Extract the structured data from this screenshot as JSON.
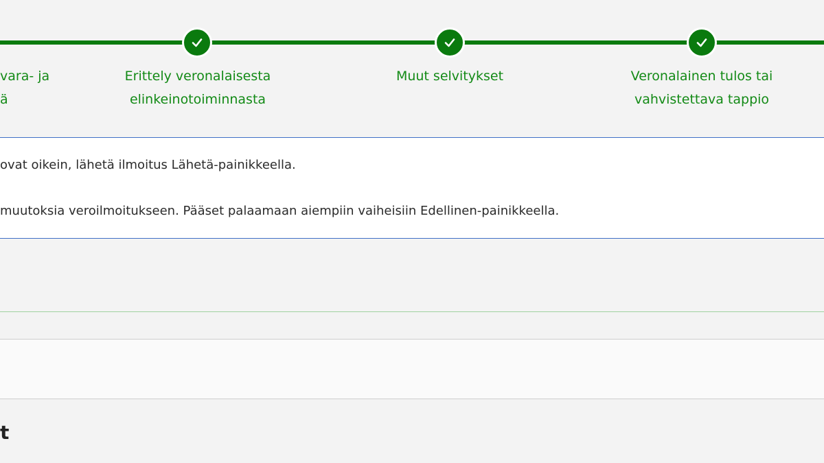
{
  "stepper": {
    "active_color": "#0a7a0e",
    "steps": [
      {
        "label_line1": "vara- ja",
        "label_line2": "ä",
        "status": "completed"
      },
      {
        "label_line1": "Erittely veronalaisesta",
        "label_line2": "elinkeinotoiminnasta",
        "status": "completed",
        "icon": "check-icon"
      },
      {
        "label_line1": "Muut selvitykset",
        "label_line2": "",
        "status": "completed",
        "icon": "check-icon"
      },
      {
        "label_line1": "Veronalainen tulos tai",
        "label_line2": "vahvistettava tappio",
        "status": "completed",
        "icon": "check-icon"
      }
    ]
  },
  "info": {
    "line1": "ovat oikein, lähetä ilmoitus Lähetä-painikkeella.",
    "line2": "muutoksia veroilmoitukseen. Pääset palaamaan aiempiin vaiheisiin Edellinen-painikkeella."
  },
  "section": {
    "heading": "t"
  }
}
